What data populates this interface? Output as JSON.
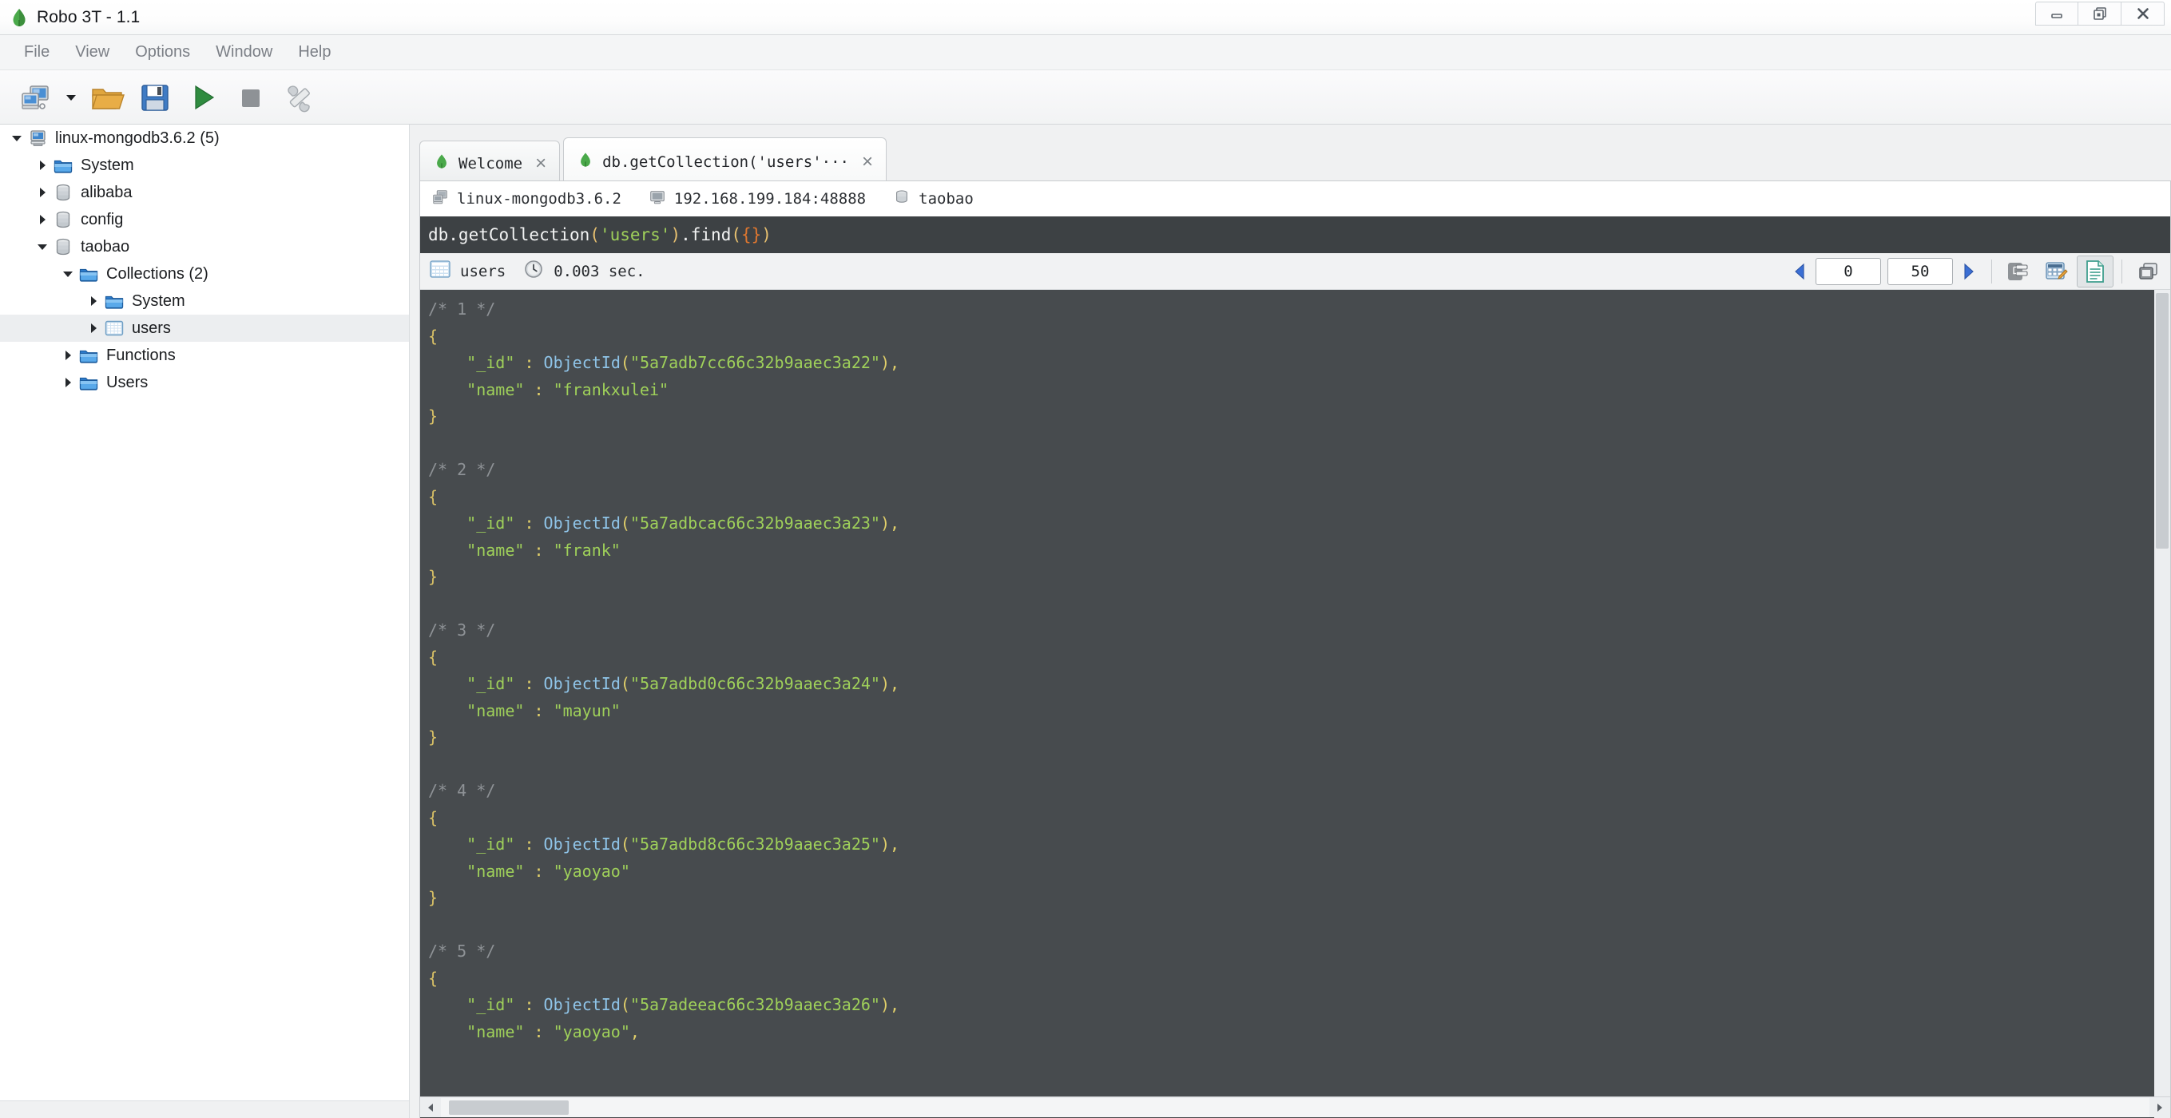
{
  "window": {
    "title": "Robo 3T - 1.1",
    "app_icon": "mongodb-leaf-icon",
    "controls": [
      {
        "name": "minimize-button",
        "glyph": "minimize-icon"
      },
      {
        "name": "restore-button",
        "glyph": "restore-icon"
      },
      {
        "name": "close-button",
        "glyph": "close-icon"
      }
    ]
  },
  "menubar": {
    "items": [
      {
        "label": "File"
      },
      {
        "label": "View"
      },
      {
        "label": "Options"
      },
      {
        "label": "Window"
      },
      {
        "label": "Help"
      }
    ]
  },
  "toolbar": {
    "buttons": [
      {
        "name": "connect-button",
        "icon": "computer-connect-icon",
        "tooltip": "Connect"
      },
      {
        "name": "connect-dropdown",
        "icon": "chevron-down-icon"
      },
      {
        "name": "open-script-button",
        "icon": "open-folder-icon"
      },
      {
        "name": "save-script-button",
        "icon": "floppy-save-icon"
      },
      {
        "name": "execute-button",
        "icon": "green-play-icon"
      },
      {
        "name": "stop-button",
        "icon": "gray-stop-icon"
      },
      {
        "name": "tools-button",
        "icon": "wrench-screwdriver-icon"
      }
    ]
  },
  "sidebar": {
    "tree": [
      {
        "label": "linux-mongodb3.6.2 (5)",
        "icon": "server-icon",
        "indent": 0,
        "twisty": "down",
        "selected": false
      },
      {
        "label": "System",
        "icon": "folder-icon",
        "indent": 1,
        "twisty": "right",
        "selected": false
      },
      {
        "label": "alibaba",
        "icon": "database-icon",
        "indent": 1,
        "twisty": "right",
        "selected": false
      },
      {
        "label": "config",
        "icon": "database-icon",
        "indent": 1,
        "twisty": "right",
        "selected": false
      },
      {
        "label": "taobao",
        "icon": "database-icon",
        "indent": 1,
        "twisty": "down",
        "selected": false
      },
      {
        "label": "Collections (2)",
        "icon": "folder-icon",
        "indent": 2,
        "twisty": "down",
        "selected": false
      },
      {
        "label": "System",
        "icon": "folder-icon",
        "indent": 3,
        "twisty": "right",
        "selected": false
      },
      {
        "label": "users",
        "icon": "collection-icon",
        "indent": 3,
        "twisty": "right",
        "selected": true
      },
      {
        "label": "Functions",
        "icon": "folder-icon",
        "indent": 2,
        "twisty": "right",
        "selected": false
      },
      {
        "label": "Users",
        "icon": "folder-icon",
        "indent": 2,
        "twisty": "right",
        "selected": false
      }
    ]
  },
  "tabs": [
    {
      "label": "Welcome",
      "icon": "mongodb-leaf-icon",
      "active": false,
      "close": "×"
    },
    {
      "label": "db.getCollection('users'···",
      "icon": "mongodb-leaf-icon",
      "active": true,
      "close": "×"
    }
  ],
  "connection_info": {
    "server": {
      "icon": "server-icon",
      "label": "linux-mongodb3.6.2"
    },
    "host": {
      "icon": "monitor-icon",
      "label": "192.168.199.184:48888"
    },
    "database": {
      "icon": "database-icon",
      "label": "taobao"
    }
  },
  "query_editor": {
    "tokens": [
      {
        "text": "db.getCollection",
        "cls": "q-plain"
      },
      {
        "text": "(",
        "cls": "q-paren"
      },
      {
        "text": "'users'",
        "cls": "q-str"
      },
      {
        "text": ")",
        "cls": "q-paren"
      },
      {
        "text": ".find",
        "cls": "q-plain"
      },
      {
        "text": "(",
        "cls": "q-paren"
      },
      {
        "text": "{}",
        "cls": "q-brace"
      },
      {
        "text": ")",
        "cls": "q-paren"
      }
    ],
    "full_text": "db.getCollection('users').find({})"
  },
  "results_toolbar": {
    "collection_icon": "table-grid-icon",
    "collection_label": "users",
    "clock_icon": "clock-icon",
    "elapsed": "0.003 sec.",
    "prev_icon": "triangle-left-icon",
    "next_icon": "triangle-right-icon",
    "skip_value": "0",
    "limit_value": "50",
    "view_buttons": [
      {
        "name": "tree-view-button",
        "icon": "tree-view-icon",
        "active": false
      },
      {
        "name": "table-view-button",
        "icon": "table-view-icon",
        "active": false
      },
      {
        "name": "text-view-button",
        "icon": "document-text-icon",
        "active": true
      },
      {
        "name": "maximize-results-button",
        "icon": "window-expand-icon",
        "active": false
      }
    ]
  },
  "results": {
    "documents": [
      {
        "index": "1",
        "_id": "5a7adb7cc66c32b9aaec3a22",
        "name": "frankxulei",
        "trailing_comma": false
      },
      {
        "index": "2",
        "_id": "5a7adbcac66c32b9aaec3a23",
        "name": "frank",
        "trailing_comma": false
      },
      {
        "index": "3",
        "_id": "5a7adbd0c66c32b9aaec3a24",
        "name": "mayun",
        "trailing_comma": false
      },
      {
        "index": "4",
        "_id": "5a7adbd8c66c32b9aaec3a25",
        "name": "yaoyao",
        "trailing_comma": false
      },
      {
        "index": "5",
        "_id": "5a7adeeac66c32b9aaec3a26",
        "name": "yaoyao",
        "trailing_comma": true
      }
    ],
    "syntax": {
      "comment": "#8e9296",
      "brace": "#d8c066",
      "key": "#9fd05a",
      "colon": "#e2d06a",
      "function": "#8fc4e8",
      "string": "#9fd05a",
      "background": "#474b4e"
    }
  },
  "colors": {
    "accent_green": "#4aa94a",
    "accent_blue": "#3b6fd4",
    "titlebar_bg": "#ffffff",
    "toolbar_bg": "#f2f3f4",
    "editor_bg": "#3d4144",
    "results_bg": "#474b4e"
  }
}
